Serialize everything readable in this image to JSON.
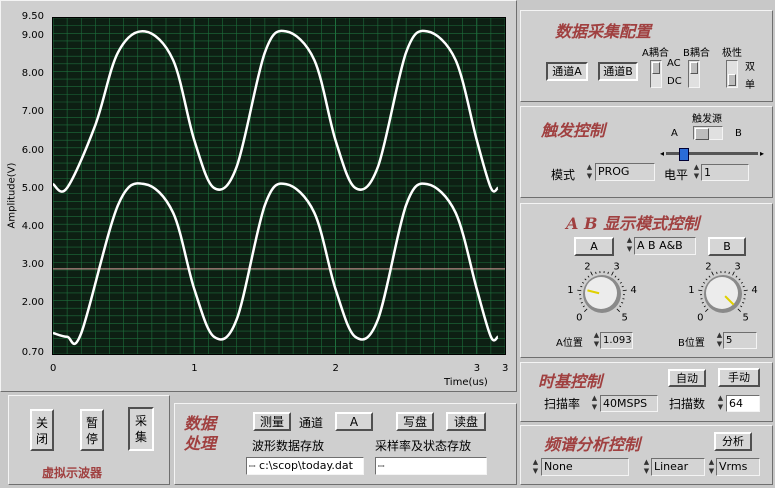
{
  "scope": {
    "y_axis_label": "Amplitude(V)",
    "x_axis_label": "Time(us)",
    "y_ticks": [
      "9.50",
      "9.00",
      "8.00",
      "7.00",
      "6.00",
      "5.00",
      "4.00",
      "3.00",
      "2.00",
      "0.70"
    ],
    "x_ticks": [
      "0",
      "1",
      "2",
      "3",
      "3"
    ],
    "colors": {
      "plot_bg": "#0d1f13",
      "grid": "#1e6e3c",
      "trace": "#ffffff",
      "cursor": "#d89a9a"
    }
  },
  "chart_data": {
    "type": "line",
    "xlabel": "Time(us)",
    "ylabel": "Amplitude(V)",
    "xlim": [
      0,
      3.2
    ],
    "ylim": [
      0.7,
      9.5
    ],
    "series": [
      {
        "x": [
          0,
          0.1,
          0.3,
          0.46,
          0.65,
          0.85,
          1.0,
          1.14,
          1.3,
          1.5,
          1.65,
          1.85,
          2.0,
          2.14,
          2.3,
          2.5,
          2.65,
          2.85,
          3.0,
          3.1,
          3.15
        ],
        "values": [
          5.15,
          5.05,
          6.7,
          8.6,
          9.15,
          8.4,
          6.3,
          5.05,
          5.6,
          8.6,
          9.15,
          8.4,
          6.3,
          5.05,
          5.6,
          8.6,
          9.15,
          8.4,
          6.3,
          5.05,
          5.05
        ]
      },
      {
        "x": [
          0,
          0.1,
          0.2,
          0.46,
          0.65,
          0.85,
          1.0,
          1.14,
          1.3,
          1.5,
          1.65,
          1.85,
          2.0,
          2.14,
          2.3,
          2.5,
          2.65,
          2.85,
          3.0,
          3.1,
          3.15
        ],
        "values": [
          1.25,
          1.15,
          1.25,
          4.6,
          5.15,
          4.4,
          2.4,
          1.15,
          1.6,
          4.6,
          5.15,
          4.4,
          2.4,
          1.15,
          1.6,
          4.6,
          5.15,
          4.4,
          2.4,
          1.15,
          1.15
        ]
      }
    ],
    "annotations": [
      {
        "type": "hline",
        "y": 2.93
      }
    ]
  },
  "bottom_left": {
    "close": "关\n闭",
    "pause": "暂\n停",
    "capture": "采\n集",
    "title": "虚拟示波器"
  },
  "data_proc": {
    "title": "数据\n处理",
    "measure": "测量",
    "channel_label": "通道",
    "channel_value": "A",
    "write": "写盘",
    "read": "读盘",
    "wave_store_label": "波形数据存放",
    "wave_path": "c:\\scop\\today.dat",
    "rate_store_label": "采样率及状态存放",
    "rate_path": ""
  },
  "acq": {
    "title": "数据采集配置",
    "ch_a": "通道A",
    "ch_b": "通道B",
    "a_coupling": "A耦合",
    "b_coupling": "B耦合",
    "polarity": "极性",
    "ac": "AC",
    "dc": "DC",
    "dual": "双",
    "single": "单"
  },
  "trigger": {
    "title": "触发控制",
    "source_label": "触发源",
    "src_a": "A",
    "src_b": "B",
    "mode_label": "模式",
    "mode_value": "PROG",
    "level_label": "电平",
    "level_value": "1",
    "slider_level": 0.08
  },
  "ab_display": {
    "title": "A B 显示模式控制",
    "btn_a": "A",
    "mode_value": "A B A&B",
    "btn_b": "B",
    "knob_ticks": [
      "0",
      "1",
      "2",
      "3",
      "4",
      "5"
    ],
    "a_pos_label": "A位置",
    "a_pos_value": "1.093",
    "b_pos_label": "B位置",
    "b_pos_value": "5"
  },
  "timebase": {
    "title": "时基控制",
    "auto": "自动",
    "manual": "手动",
    "rate_label": "扫描率",
    "rate_value": "40MSPS",
    "count_label": "扫描数",
    "count_value": "64"
  },
  "spectrum": {
    "title": "频谱分析控制",
    "analyze": "分析",
    "window": "None",
    "scale": "Linear",
    "unit": "Vrms"
  }
}
